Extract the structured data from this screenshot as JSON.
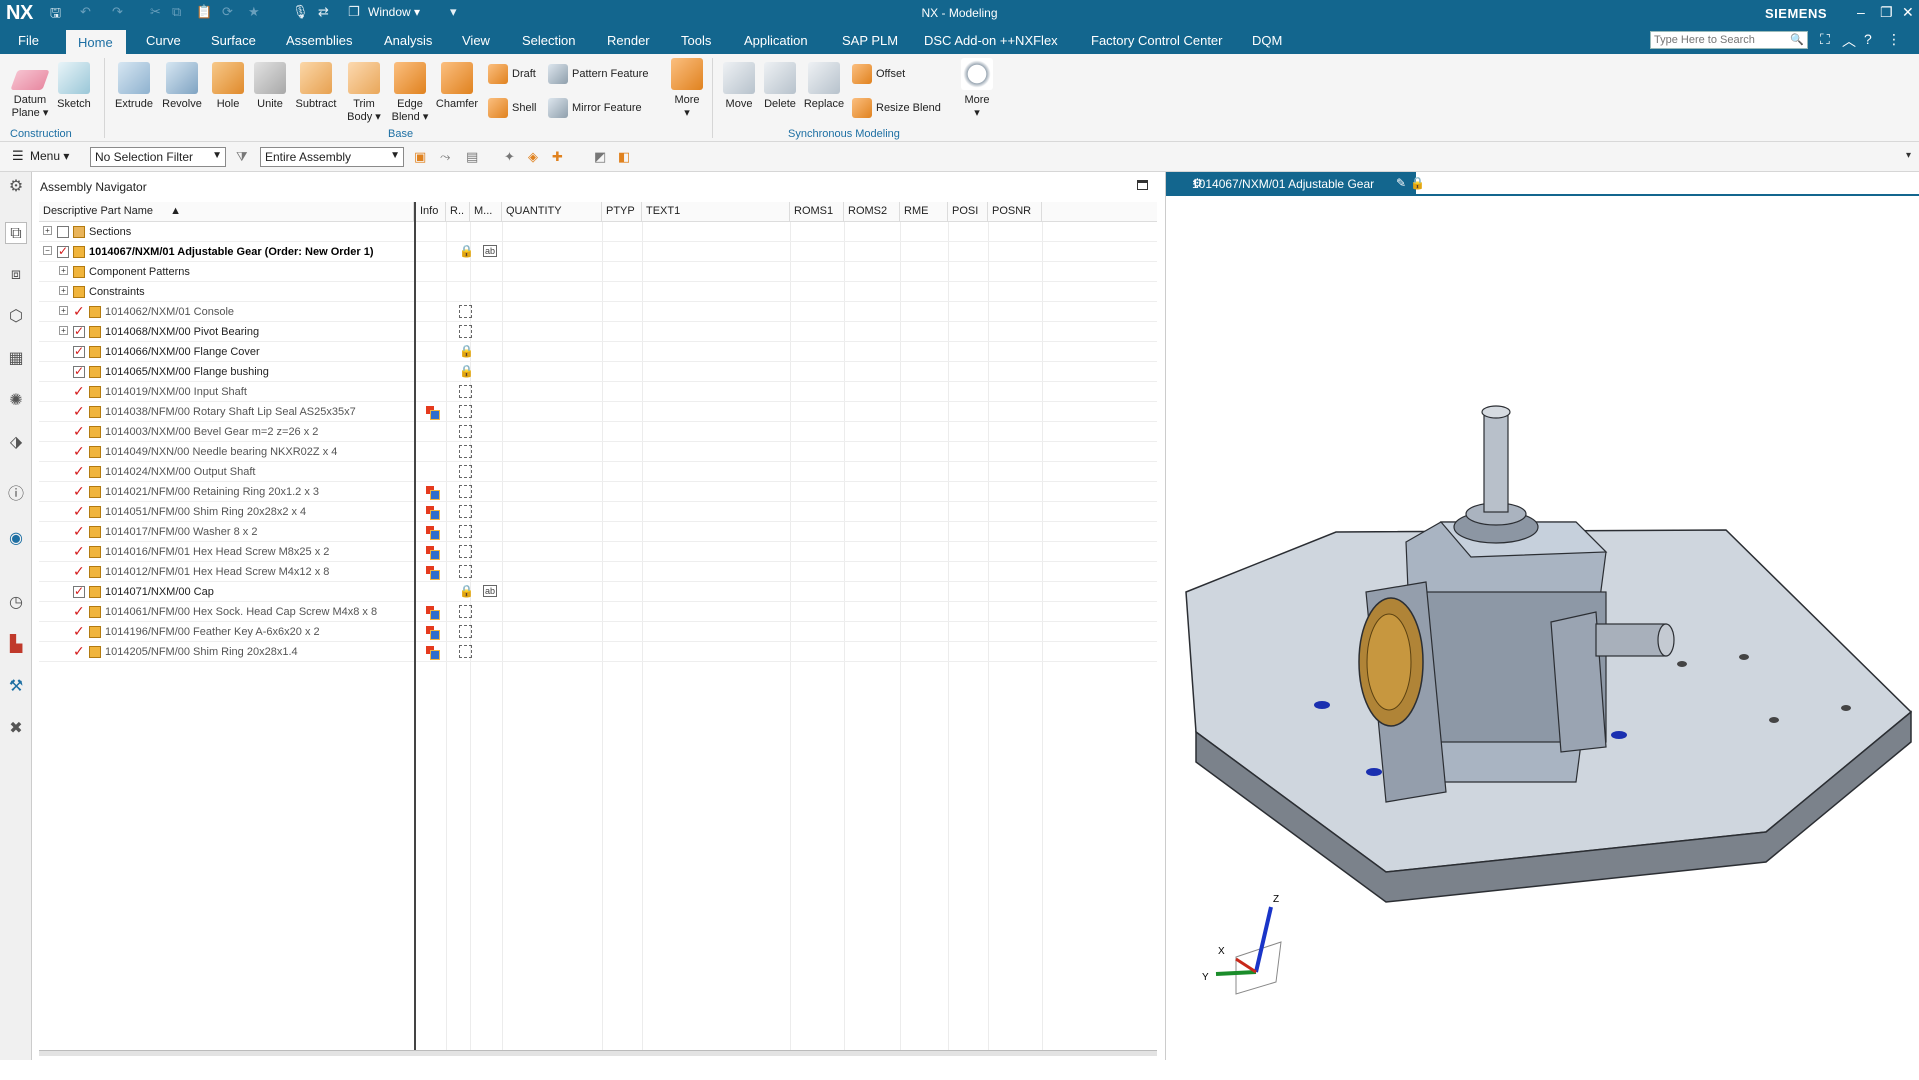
{
  "app": {
    "logo": "NX",
    "window_menu": "Window ▾",
    "title": "NX - Modeling",
    "brand": "SIEMENS"
  },
  "menu_tabs": [
    "File",
    "Home",
    "Curve",
    "Surface",
    "Assemblies",
    "Analysis",
    "View",
    "Selection",
    "Render",
    "Tools",
    "Application",
    "SAP PLM",
    "DSC Add-on ++NXFlex",
    "Factory Control Center",
    "DQM"
  ],
  "active_tab": "Home",
  "search": {
    "placeholder": "Type Here to Search"
  },
  "ribbon": {
    "construction": {
      "datum_plane": "Datum Plane ▾",
      "sketch": "Sketch",
      "label": "Construction"
    },
    "base": {
      "extrude": "Extrude",
      "revolve": "Revolve",
      "hole": "Hole",
      "unite": "Unite",
      "subtract": "Subtract",
      "trim_body": "Trim Body ▾",
      "edge_blend": "Edge Blend ▾",
      "chamfer": "Chamfer",
      "draft": "Draft",
      "shell": "Shell",
      "pattern_feature": "Pattern Feature",
      "mirror_feature": "Mirror Feature",
      "more": "More",
      "label": "Base"
    },
    "sync": {
      "move": "Move",
      "delete": "Delete",
      "replace": "Replace",
      "offset": "Offset",
      "resize_blend": "Resize Blend",
      "more": "More",
      "label": "Synchronous Modeling"
    }
  },
  "selection_bar": {
    "menu": "Menu ▾",
    "filter": "No Selection Filter",
    "scope": "Entire Assembly"
  },
  "navigator": {
    "title": "Assembly Navigator",
    "columns": [
      "Descriptive Part Name",
      "Info",
      "R..",
      "M...",
      "QUANTITY",
      "PTYP",
      "TEXT1",
      "ROMS1",
      "ROMS2",
      "RME",
      "POSI",
      "POSNR"
    ],
    "rows": [
      {
        "name": "Sections",
        "style": "plain",
        "indent": 0,
        "exp": "+",
        "chk": "empty",
        "info": false,
        "r": "",
        "m": ""
      },
      {
        "name": "1014067/NXM/01 Adjustable Gear (Order: New Order 1)",
        "style": "bold",
        "indent": 0,
        "exp": "−",
        "chk": "on",
        "info": false,
        "r": "lock",
        "m": "mic"
      },
      {
        "name": "Component Patterns",
        "style": "plain",
        "indent": 1,
        "exp": "+",
        "chk": "none",
        "info": false,
        "r": "",
        "m": ""
      },
      {
        "name": "Constraints",
        "style": "plain",
        "indent": 1,
        "exp": "+",
        "chk": "none",
        "info": false,
        "r": "",
        "m": ""
      },
      {
        "name": "1014062/NXM/01 Console",
        "style": "dim",
        "indent": 1,
        "exp": "+",
        "chk": "tick",
        "info": false,
        "r": "dash",
        "m": ""
      },
      {
        "name": "1014068/NXM/00 Pivot Bearing",
        "style": "plain",
        "indent": 1,
        "exp": "+",
        "chk": "on",
        "info": false,
        "r": "dash",
        "m": ""
      },
      {
        "name": "1014066/NXM/00 Flange Cover",
        "style": "plain",
        "indent": 1,
        "exp": "",
        "chk": "on",
        "info": false,
        "r": "lock",
        "m": ""
      },
      {
        "name": "1014065/NXM/00 Flange bushing",
        "style": "plain",
        "indent": 1,
        "exp": "",
        "chk": "on",
        "info": false,
        "r": "lock",
        "m": ""
      },
      {
        "name": "1014019/NXM/00 Input Shaft",
        "style": "dim",
        "indent": 1,
        "exp": "",
        "chk": "tick",
        "info": false,
        "r": "dash",
        "m": ""
      },
      {
        "name": "1014038/NFM/00 Rotary Shaft Lip Seal AS25x35x7",
        "style": "dim",
        "indent": 1,
        "exp": "",
        "chk": "tick",
        "info": true,
        "r": "dash",
        "m": ""
      },
      {
        "name": "1014003/NXM/00 Bevel Gear m=2 z=26 x 2",
        "style": "dim",
        "indent": 1,
        "exp": "",
        "chk": "tick",
        "info": false,
        "r": "dash",
        "m": ""
      },
      {
        "name": "1014049/NXN/00 Needle bearing NKXR02Z x 4",
        "style": "dim",
        "indent": 1,
        "exp": "",
        "chk": "tick",
        "info": false,
        "r": "dash",
        "m": ""
      },
      {
        "name": "1014024/NXM/00 Output Shaft",
        "style": "dim",
        "indent": 1,
        "exp": "",
        "chk": "tick",
        "info": false,
        "r": "dash",
        "m": ""
      },
      {
        "name": "1014021/NFM/00 Retaining Ring 20x1.2 x 3",
        "style": "dim",
        "indent": 1,
        "exp": "",
        "chk": "tick",
        "info": true,
        "r": "dash",
        "m": ""
      },
      {
        "name": "1014051/NFM/00 Shim Ring 20x28x2 x 4",
        "style": "dim",
        "indent": 1,
        "exp": "",
        "chk": "tick",
        "info": true,
        "r": "dash",
        "m": ""
      },
      {
        "name": "1014017/NFM/00 Washer 8 x 2",
        "style": "dim",
        "indent": 1,
        "exp": "",
        "chk": "tick",
        "info": true,
        "r": "dash",
        "m": ""
      },
      {
        "name": "1014016/NFM/01 Hex Head Screw M8x25 x 2",
        "style": "dim",
        "indent": 1,
        "exp": "",
        "chk": "tick",
        "info": true,
        "r": "dash",
        "m": ""
      },
      {
        "name": "1014012/NFM/01 Hex Head Screw M4x12 x 8",
        "style": "dim",
        "indent": 1,
        "exp": "",
        "chk": "tick",
        "info": true,
        "r": "dash",
        "m": ""
      },
      {
        "name": "1014071/NXM/00 Cap",
        "style": "plain",
        "indent": 1,
        "exp": "",
        "chk": "on",
        "info": false,
        "r": "lock",
        "m": "mic"
      },
      {
        "name": "1014061/NFM/00 Hex Sock. Head Cap Screw M4x8 x 8",
        "style": "dim",
        "indent": 1,
        "exp": "",
        "chk": "tick",
        "info": true,
        "r": "dash",
        "m": ""
      },
      {
        "name": "1014196/NFM/00 Feather Key A-6x6x20 x 2",
        "style": "dim",
        "indent": 1,
        "exp": "",
        "chk": "tick",
        "info": true,
        "r": "dash",
        "m": ""
      },
      {
        "name": "1014205/NFM/00 Shim Ring 20x28x1.4",
        "style": "dim",
        "indent": 1,
        "exp": "",
        "chk": "tick",
        "info": true,
        "r": "dash",
        "m": ""
      }
    ]
  },
  "viewport": {
    "tab_title": "1014067/NXM/01 Adjustable Gear",
    "axes": {
      "x": "X",
      "y": "Y",
      "z": "Z"
    }
  },
  "colors": {
    "chrome": "#13668e",
    "accent": "#1d6fa3",
    "check": "#d31c1c"
  }
}
